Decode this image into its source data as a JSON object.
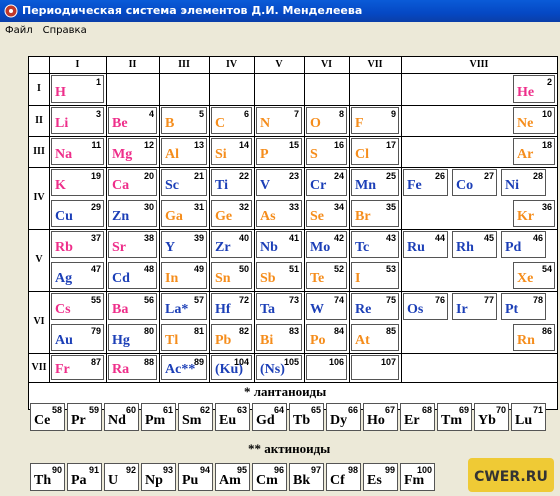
{
  "window": {
    "title": "Периодическая система элементов Д.И. Менделеева"
  },
  "menu": {
    "items": [
      "Файл",
      "Справка"
    ]
  },
  "colors": {
    "s": "#ee2e8a",
    "p": "#f58d1c",
    "d": "#1c3fb7",
    "f": "#000000"
  },
  "groups": [
    "I",
    "II",
    "III",
    "IV",
    "V",
    "VI",
    "VII",
    "VIII"
  ],
  "periods": [
    "I",
    "II",
    "III",
    "IV",
    "V",
    "VI",
    "VII"
  ],
  "elements": [
    {
      "n": "1",
      "s": "H",
      "c": "s"
    },
    {
      "n": "2",
      "s": "He",
      "c": "s"
    },
    {
      "n": "3",
      "s": "Li",
      "c": "s"
    },
    {
      "n": "4",
      "s": "Be",
      "c": "s"
    },
    {
      "n": "5",
      "s": "B",
      "c": "p"
    },
    {
      "n": "6",
      "s": "C",
      "c": "p"
    },
    {
      "n": "7",
      "s": "N",
      "c": "p"
    },
    {
      "n": "8",
      "s": "O",
      "c": "p"
    },
    {
      "n": "9",
      "s": "F",
      "c": "p"
    },
    {
      "n": "10",
      "s": "Ne",
      "c": "p"
    },
    {
      "n": "11",
      "s": "Na",
      "c": "s"
    },
    {
      "n": "12",
      "s": "Mg",
      "c": "s"
    },
    {
      "n": "13",
      "s": "Al",
      "c": "p"
    },
    {
      "n": "14",
      "s": "Si",
      "c": "p"
    },
    {
      "n": "15",
      "s": "P",
      "c": "p"
    },
    {
      "n": "16",
      "s": "S",
      "c": "p"
    },
    {
      "n": "17",
      "s": "Cl",
      "c": "p"
    },
    {
      "n": "18",
      "s": "Ar",
      "c": "p"
    },
    {
      "n": "19",
      "s": "K",
      "c": "s"
    },
    {
      "n": "20",
      "s": "Ca",
      "c": "s"
    },
    {
      "n": "21",
      "s": "Sc",
      "c": "d"
    },
    {
      "n": "22",
      "s": "Ti",
      "c": "d"
    },
    {
      "n": "23",
      "s": "V",
      "c": "d"
    },
    {
      "n": "24",
      "s": "Cr",
      "c": "d"
    },
    {
      "n": "25",
      "s": "Mn",
      "c": "d"
    },
    {
      "n": "26",
      "s": "Fe",
      "c": "d"
    },
    {
      "n": "27",
      "s": "Co",
      "c": "d"
    },
    {
      "n": "28",
      "s": "Ni",
      "c": "d"
    },
    {
      "n": "29",
      "s": "Cu",
      "c": "d"
    },
    {
      "n": "30",
      "s": "Zn",
      "c": "d"
    },
    {
      "n": "31",
      "s": "Ga",
      "c": "p"
    },
    {
      "n": "32",
      "s": "Ge",
      "c": "p"
    },
    {
      "n": "33",
      "s": "As",
      "c": "p"
    },
    {
      "n": "34",
      "s": "Se",
      "c": "p"
    },
    {
      "n": "35",
      "s": "Br",
      "c": "p"
    },
    {
      "n": "36",
      "s": "Kr",
      "c": "p"
    },
    {
      "n": "37",
      "s": "Rb",
      "c": "s"
    },
    {
      "n": "38",
      "s": "Sr",
      "c": "s"
    },
    {
      "n": "39",
      "s": "Y",
      "c": "d"
    },
    {
      "n": "40",
      "s": "Zr",
      "c": "d"
    },
    {
      "n": "41",
      "s": "Nb",
      "c": "d"
    },
    {
      "n": "42",
      "s": "Mo",
      "c": "d"
    },
    {
      "n": "43",
      "s": "Tc",
      "c": "d"
    },
    {
      "n": "44",
      "s": "Ru",
      "c": "d"
    },
    {
      "n": "45",
      "s": "Rh",
      "c": "d"
    },
    {
      "n": "46",
      "s": "Pd",
      "c": "d"
    },
    {
      "n": "47",
      "s": "Ag",
      "c": "d"
    },
    {
      "n": "48",
      "s": "Cd",
      "c": "d"
    },
    {
      "n": "49",
      "s": "In",
      "c": "p"
    },
    {
      "n": "50",
      "s": "Sn",
      "c": "p"
    },
    {
      "n": "51",
      "s": "Sb",
      "c": "p"
    },
    {
      "n": "52",
      "s": "Te",
      "c": "p"
    },
    {
      "n": "53",
      "s": "I",
      "c": "p"
    },
    {
      "n": "54",
      "s": "Xe",
      "c": "p"
    },
    {
      "n": "55",
      "s": "Cs",
      "c": "s"
    },
    {
      "n": "56",
      "s": "Ba",
      "c": "s"
    },
    {
      "n": "57",
      "s": "La*",
      "c": "d"
    },
    {
      "n": "72",
      "s": "Hf",
      "c": "d"
    },
    {
      "n": "73",
      "s": "Ta",
      "c": "d"
    },
    {
      "n": "74",
      "s": "W",
      "c": "d"
    },
    {
      "n": "75",
      "s": "Re",
      "c": "d"
    },
    {
      "n": "76",
      "s": "Os",
      "c": "d"
    },
    {
      "n": "77",
      "s": "Ir",
      "c": "d"
    },
    {
      "n": "78",
      "s": "Pt",
      "c": "d"
    },
    {
      "n": "79",
      "s": "Au",
      "c": "d"
    },
    {
      "n": "80",
      "s": "Hg",
      "c": "d"
    },
    {
      "n": "81",
      "s": "Tl",
      "c": "p"
    },
    {
      "n": "82",
      "s": "Pb",
      "c": "p"
    },
    {
      "n": "83",
      "s": "Bi",
      "c": "p"
    },
    {
      "n": "84",
      "s": "Po",
      "c": "p"
    },
    {
      "n": "85",
      "s": "At",
      "c": "p"
    },
    {
      "n": "86",
      "s": "Rn",
      "c": "p"
    },
    {
      "n": "87",
      "s": "Fr",
      "c": "s"
    },
    {
      "n": "88",
      "s": "Ra",
      "c": "s"
    },
    {
      "n": "89",
      "s": "Ac**",
      "c": "d"
    },
    {
      "n": "104",
      "s": "(Ku)",
      "c": "d"
    },
    {
      "n": "105",
      "s": "(Ns)",
      "c": "d"
    },
    {
      "n": "106",
      "s": "",
      "c": "d"
    },
    {
      "n": "107",
      "s": "",
      "c": "d"
    }
  ],
  "lanthanides": {
    "label": "* лантаноиды",
    "items": [
      {
        "n": "58",
        "s": "Ce"
      },
      {
        "n": "59",
        "s": "Pr"
      },
      {
        "n": "60",
        "s": "Nd"
      },
      {
        "n": "61",
        "s": "Pm"
      },
      {
        "n": "62",
        "s": "Sm"
      },
      {
        "n": "63",
        "s": "Eu"
      },
      {
        "n": "64",
        "s": "Gd"
      },
      {
        "n": "65",
        "s": "Tb"
      },
      {
        "n": "66",
        "s": "Dy"
      },
      {
        "n": "67",
        "s": "Ho"
      },
      {
        "n": "68",
        "s": "Er"
      },
      {
        "n": "69",
        "s": "Tm"
      },
      {
        "n": "70",
        "s": "Yb"
      },
      {
        "n": "71",
        "s": "Lu"
      }
    ]
  },
  "actinides": {
    "label": "** актиноиды",
    "items": [
      {
        "n": "90",
        "s": "Th"
      },
      {
        "n": "91",
        "s": "Pa"
      },
      {
        "n": "92",
        "s": "U"
      },
      {
        "n": "93",
        "s": "Np"
      },
      {
        "n": "94",
        "s": "Pu"
      },
      {
        "n": "95",
        "s": "Am"
      },
      {
        "n": "96",
        "s": "Cm"
      },
      {
        "n": "97",
        "s": "Bk"
      },
      {
        "n": "98",
        "s": "Cf"
      },
      {
        "n": "99",
        "s": "Es"
      },
      {
        "n": "100",
        "s": "Fm"
      }
    ]
  },
  "watermark": {
    "text": "CWER.RU"
  }
}
